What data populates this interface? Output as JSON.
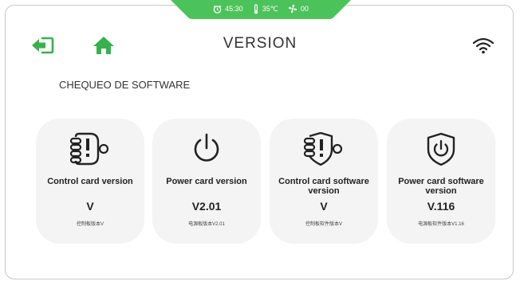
{
  "status": {
    "time": "45:30",
    "temperature": "35℃",
    "fan": "00",
    "color": "#4cc35a"
  },
  "header": {
    "title": "VERSION",
    "accent": "#35b24a"
  },
  "section": {
    "title": "CHEQUEO DE SOFTWARE"
  },
  "cards": [
    {
      "name": "Control card version",
      "value": "V",
      "sub": "控制板版本V",
      "icon": "chip-plug-icon"
    },
    {
      "name": "Power card version",
      "value": "V2.01",
      "sub": "电源板版本V2.01",
      "icon": "power-icon"
    },
    {
      "name": "Control card software version",
      "value": "V",
      "sub": "控制板软件版本V",
      "icon": "shield-chip-icon"
    },
    {
      "name": "Power card software version",
      "value": "V.116",
      "sub": "电源板软件版本V1.16",
      "icon": "shield-power-icon"
    }
  ]
}
